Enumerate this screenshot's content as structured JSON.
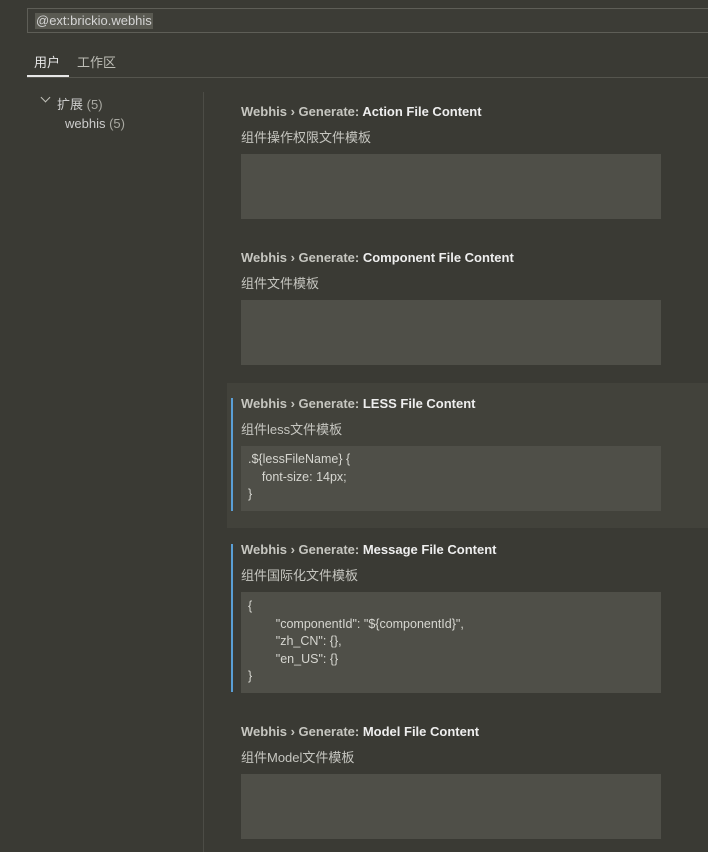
{
  "search": {
    "value": "@ext:brickio.webhis"
  },
  "tabs": [
    {
      "label": "用户"
    },
    {
      "label": "工作区"
    }
  ],
  "tree": {
    "group": {
      "label": "扩展",
      "count": "(5)"
    },
    "item": {
      "label": "webhis",
      "count": "(5)"
    }
  },
  "settings": [
    {
      "category": "Webhis › Generate: ",
      "name": "Action File Content",
      "description": "组件操作权限文件模板",
      "value": ""
    },
    {
      "category": "Webhis › Generate: ",
      "name": "Component File Content",
      "description": "组件文件模板",
      "value": ""
    },
    {
      "category": "Webhis › Generate: ",
      "name": "LESS File Content",
      "description": "组件less文件模板",
      "value": ".${lessFileName} {\n    font-size: 14px;\n}"
    },
    {
      "category": "Webhis › Generate: ",
      "name": "Message File Content",
      "description": "组件国际化文件模板",
      "value": "{\n        \"componentId\": \"${componentId}\",\n        \"zh_CN\": {},\n        \"en_US\": {}\n}"
    },
    {
      "category": "Webhis › Generate: ",
      "name": "Model File Content",
      "description": "组件Model文件模板",
      "value": ""
    }
  ]
}
